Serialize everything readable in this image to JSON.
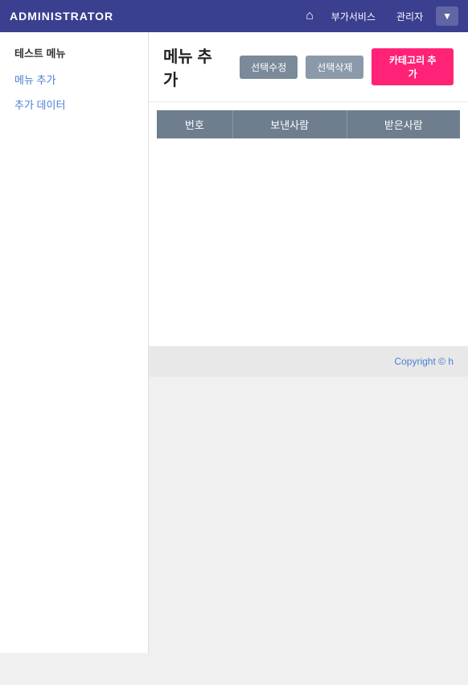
{
  "header": {
    "title": "ADMINISTRATOR",
    "home_icon": "⌂",
    "nav_items": [
      "부가서비스",
      "관리자"
    ],
    "dropdown_icon": "▼"
  },
  "sidebar": {
    "section_title": "테스트 메뉴",
    "items": [
      {
        "label": "메뉴 추가"
      },
      {
        "label": "추가 데이터"
      }
    ]
  },
  "main": {
    "page_title": "메뉴 추가",
    "buttons": {
      "edit": "선택수정",
      "delete": "선택삭제",
      "add_category": "카테고리 추가"
    },
    "table": {
      "columns": [
        "번호",
        "보낸사람",
        "받은사람"
      ],
      "rows": []
    }
  },
  "footer": {
    "text": "Copyright © h"
  }
}
